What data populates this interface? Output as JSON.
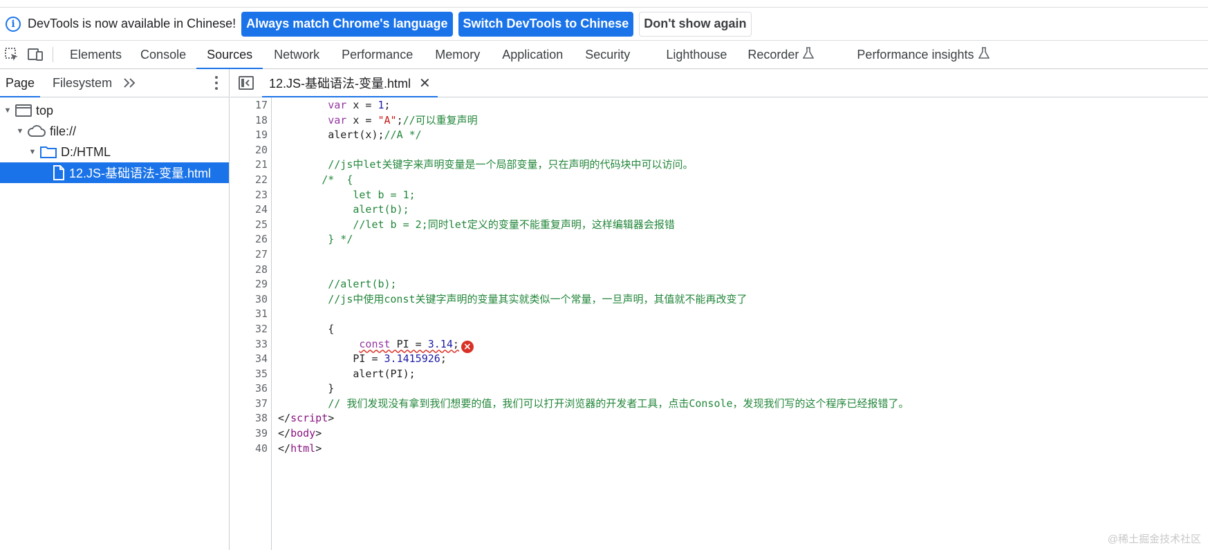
{
  "infobar": {
    "message": "DevTools is now available in Chinese!",
    "buttons": [
      "Always match Chrome's language",
      "Switch DevTools to Chinese",
      "Don't show again"
    ]
  },
  "toolbar": {
    "tabs": [
      "Elements",
      "Console",
      "Sources",
      "Network",
      "Performance",
      "Memory",
      "Application",
      "Security",
      "Lighthouse",
      "Recorder",
      "Performance insights"
    ],
    "active_tab": "Sources"
  },
  "navigator": {
    "tabs": [
      "Page",
      "Filesystem"
    ],
    "more": "»",
    "tree": [
      {
        "label": "top",
        "level": 0,
        "icon": "frame-icon"
      },
      {
        "label": "file://",
        "level": 1,
        "icon": "cloud-icon"
      },
      {
        "label": "D:/HTML",
        "level": 2,
        "icon": "folder-icon"
      },
      {
        "label": "12.JS-基础语法-变量.html",
        "level": 3,
        "icon": "file-icon",
        "selected": true
      }
    ]
  },
  "editor": {
    "open_file": "12.JS-基础语法-变量.html",
    "lines": [
      {
        "n": "17",
        "segments": [
          [
            "def",
            "        "
          ],
          [
            "kw",
            "var"
          ],
          [
            "def",
            " x = "
          ],
          [
            "num",
            "1"
          ],
          [
            "def",
            ";"
          ]
        ]
      },
      {
        "n": "18",
        "segments": [
          [
            "def",
            "        "
          ],
          [
            "kw",
            "var"
          ],
          [
            "def",
            " x = "
          ],
          [
            "str",
            "\"A\""
          ],
          [
            "def",
            ";"
          ],
          [
            "com",
            "//可以重复声明"
          ]
        ]
      },
      {
        "n": "19",
        "segments": [
          [
            "def",
            "        alert(x);"
          ],
          [
            "com",
            "//A */"
          ]
        ]
      },
      {
        "n": "20",
        "segments": []
      },
      {
        "n": "21",
        "segments": [
          [
            "com",
            "        //js中let关键字来声明变量是一个局部变量，只在声明的代码块中可以访问。"
          ]
        ]
      },
      {
        "n": "22",
        "segments": [
          [
            "com",
            "       /*  {"
          ]
        ]
      },
      {
        "n": "23",
        "segments": [
          [
            "com",
            "            let b = 1;"
          ]
        ]
      },
      {
        "n": "24",
        "segments": [
          [
            "com",
            "            alert(b);"
          ]
        ]
      },
      {
        "n": "25",
        "segments": [
          [
            "com",
            "            //let b = 2;同时let定义的变量不能重复声明，这样编辑器会报错"
          ]
        ]
      },
      {
        "n": "26",
        "segments": [
          [
            "com",
            "        } */"
          ]
        ]
      },
      {
        "n": "27",
        "segments": []
      },
      {
        "n": "28",
        "segments": []
      },
      {
        "n": "29",
        "segments": [
          [
            "com",
            "        //alert(b);"
          ]
        ]
      },
      {
        "n": "30",
        "segments": [
          [
            "com",
            "        //js中使用const关键字声明的变量其实就类似一个常量，一旦声明，其值就不能再改变了"
          ]
        ]
      },
      {
        "n": "31",
        "segments": []
      },
      {
        "n": "32",
        "segments": [
          [
            "def",
            "        {"
          ]
        ]
      },
      {
        "n": "33",
        "segments": [
          [
            "def",
            "             "
          ],
          [
            "kwsq",
            "const"
          ],
          [
            "defsq",
            " PI = "
          ],
          [
            "numsq",
            "3.14"
          ],
          [
            "defsq",
            ";"
          ]
        ],
        "error": true
      },
      {
        "n": "34",
        "segments": [
          [
            "def",
            "            PI = "
          ],
          [
            "num",
            "3.1415926"
          ],
          [
            "def",
            ";"
          ]
        ]
      },
      {
        "n": "35",
        "segments": [
          [
            "def",
            "            alert(PI);"
          ]
        ]
      },
      {
        "n": "36",
        "segments": [
          [
            "def",
            "        }"
          ]
        ]
      },
      {
        "n": "37",
        "segments": [
          [
            "com",
            "        // 我们发现没有拿到我们想要的值，我们可以打开浏览器的开发者工具，点击Console，发现我们写的这个程序已经报错了。"
          ]
        ]
      },
      {
        "n": "38",
        "segments": [
          [
            "def",
            "</"
          ],
          [
            "tag",
            "script"
          ],
          [
            "def",
            ">"
          ]
        ]
      },
      {
        "n": "39",
        "segments": [
          [
            "def",
            "</"
          ],
          [
            "tag",
            "body"
          ],
          [
            "def",
            ">"
          ]
        ]
      },
      {
        "n": "40",
        "segments": [
          [
            "def",
            "</"
          ],
          [
            "tag",
            "html"
          ],
          [
            "def",
            ">"
          ]
        ]
      }
    ],
    "error_icon": "error-icon"
  },
  "watermark": "@稀土掘金技术社区",
  "colors": {
    "accent": "#1a73e8",
    "error": "#d93025"
  }
}
